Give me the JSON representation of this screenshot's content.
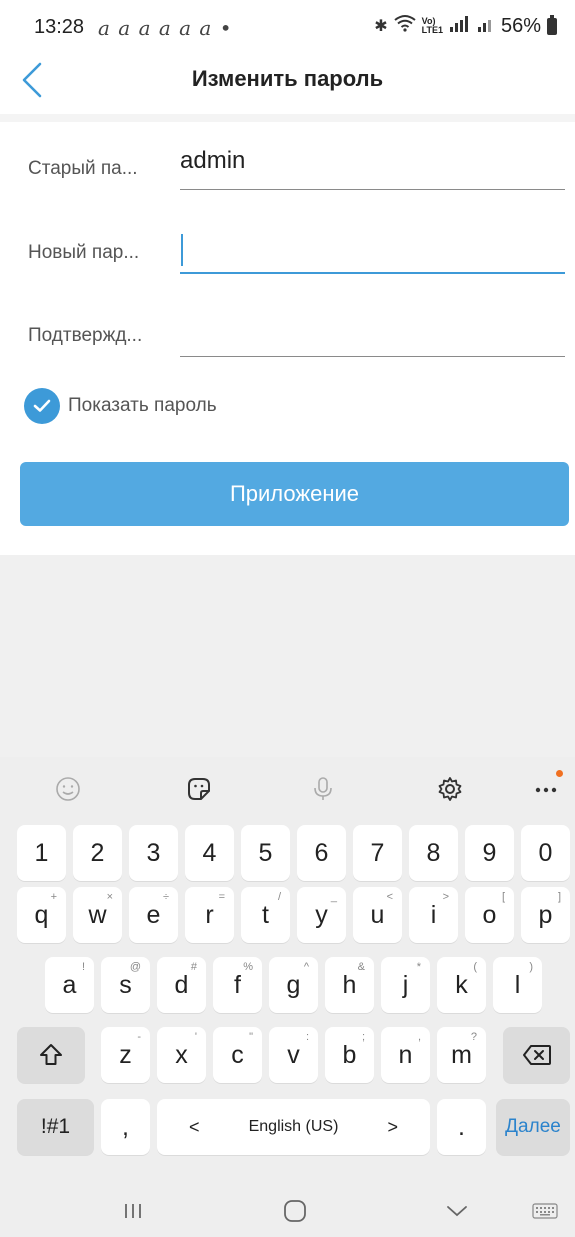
{
  "status_bar": {
    "time": "13:28",
    "notifications": "a a a a a a •",
    "battery_text": "56%"
  },
  "header": {
    "title": "Изменить пароль"
  },
  "form": {
    "old_password_label": "Старый па...",
    "old_password_value": "admin",
    "new_password_label": "Новый пар...",
    "new_password_value": "",
    "confirm_label": "Подтвержд...",
    "confirm_value": "",
    "show_password_label": "Показать пароль",
    "show_password_checked": true,
    "apply_button": "Приложение"
  },
  "colors": {
    "accent": "#3d9ad8",
    "button": "#53a9e1",
    "keyboard_bg": "#eeeeee"
  },
  "keyboard": {
    "toolbar_icons": [
      "emoji-icon",
      "sticker-icon",
      "microphone-icon",
      "settings-gear-icon",
      "more-options-icon"
    ],
    "number_row": [
      "1",
      "2",
      "3",
      "4",
      "5",
      "6",
      "7",
      "8",
      "9",
      "0"
    ],
    "row1": [
      "q",
      "w",
      "e",
      "r",
      "t",
      "y",
      "u",
      "i",
      "o",
      "p"
    ],
    "row1_sub": [
      "+",
      "×",
      "÷",
      "=",
      "/",
      "_",
      "<",
      ">",
      "[",
      "]"
    ],
    "row2": [
      "a",
      "s",
      "d",
      "f",
      "g",
      "h",
      "j",
      "k",
      "l"
    ],
    "row2_sub": [
      "!",
      "@",
      "#",
      "%",
      "^",
      "&",
      "*",
      "(",
      ")"
    ],
    "row3": [
      "z",
      "x",
      "c",
      "v",
      "b",
      "n",
      "m"
    ],
    "row3_sub": [
      "-",
      "'",
      "\"",
      ":",
      ";",
      ",",
      "?"
    ],
    "symbols_key": "!#1",
    "comma_key": ",",
    "space_label": "English (US)",
    "space_left_arrow": "<",
    "space_right_arrow": ">",
    "period_key": ".",
    "enter_key": "Далее"
  }
}
